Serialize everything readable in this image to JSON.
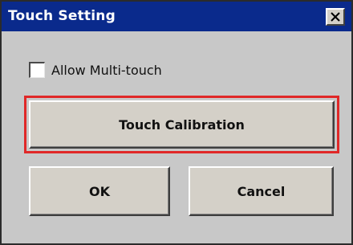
{
  "window": {
    "title": "Touch Setting",
    "close_icon": "close-icon"
  },
  "options": {
    "multitouch_label": "Allow Multi-touch",
    "multitouch_checked": false
  },
  "buttons": {
    "calibration_label": "Touch Calibration",
    "ok_label": "OK",
    "cancel_label": "Cancel"
  },
  "colors": {
    "titlebar": "#0a2a8c",
    "dialog_bg": "#c8c8c8",
    "highlight": "#e02828"
  }
}
